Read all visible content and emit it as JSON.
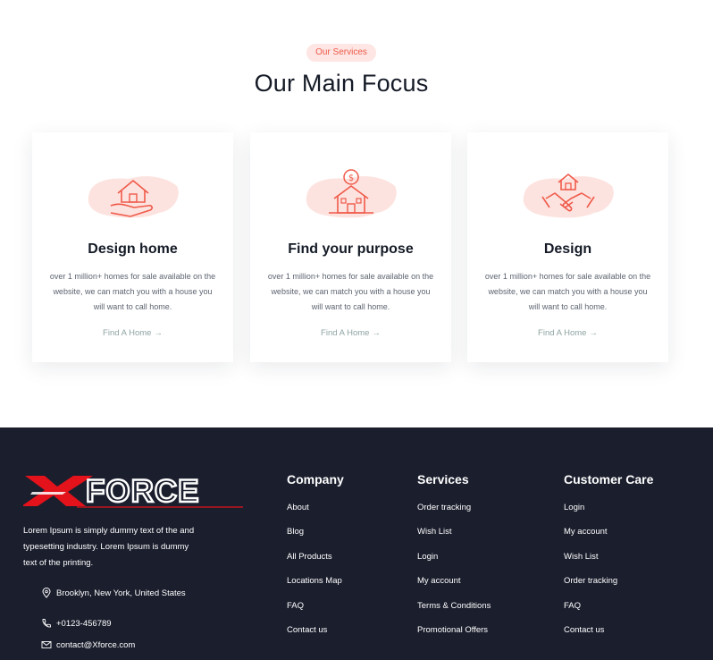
{
  "services": {
    "badge": "Our Services",
    "title": "Our Main Focus",
    "cards": [
      {
        "icon": "house-in-hand-icon",
        "title": "Design home",
        "text": "over 1 million+ homes for sale available on the website, we can match you with a house you will want to call home.",
        "link": "Find A Home"
      },
      {
        "icon": "dollar-house-icon",
        "title": "Find your purpose",
        "text": "over 1 million+ homes for sale available on the website, we can match you with a house you will want to call home.",
        "link": "Find A Home"
      },
      {
        "icon": "handshake-house-icon",
        "title": "Design",
        "text": "over 1 million+ homes for sale available on the website, we can match you with a house you will want to call home.",
        "link": "Find A Home"
      }
    ]
  },
  "footer": {
    "logo_text": "XFORCE",
    "about": "Lorem Ipsum is simply dummy text of the and typesetting industry. Lorem Ipsum is dummy text of the printing.",
    "contact": {
      "address": "Brooklyn, New York, United States",
      "phone": "+0123-456789",
      "email": "contact@Xforce.com"
    },
    "columns": [
      {
        "title": "Company",
        "items": [
          "About",
          "Blog",
          "All Products",
          "Locations Map",
          "FAQ",
          "Contact us"
        ]
      },
      {
        "title": "Services",
        "items": [
          "Order tracking",
          "Wish List",
          "Login",
          "My account",
          "Terms & Conditions",
          "Promotional Offers"
        ]
      },
      {
        "title": "Customer Care",
        "items": [
          "Login",
          "My account",
          "Wish List",
          "Order tracking",
          "FAQ",
          "Contact us"
        ]
      }
    ]
  },
  "colors": {
    "accent": "#ef5a4a",
    "accent_soft": "#fde6e3",
    "footer_bg": "#1b1e2d",
    "logo_red": "#e3121b",
    "link_muted": "#8fa3a2"
  }
}
